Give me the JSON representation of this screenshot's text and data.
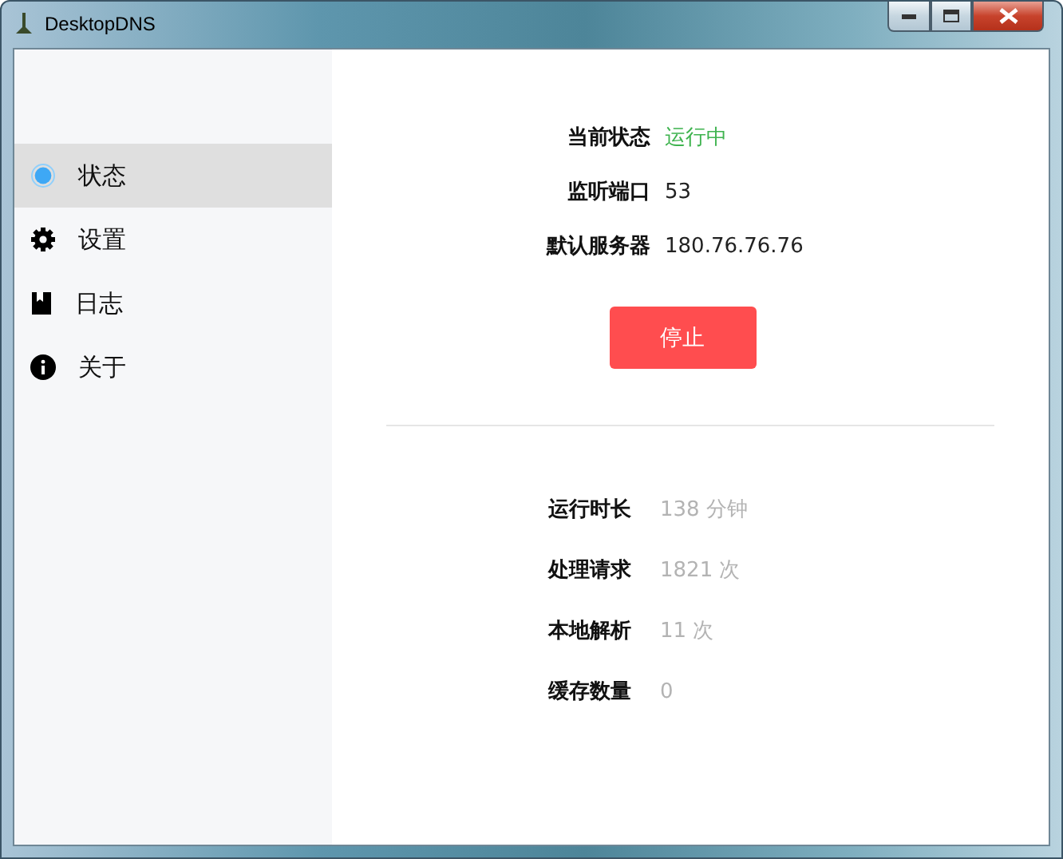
{
  "window": {
    "title": "DesktopDNS"
  },
  "sidebar": {
    "items": [
      {
        "label": "状态",
        "selected": true
      },
      {
        "label": "设置",
        "selected": false
      },
      {
        "label": "日志",
        "selected": false
      },
      {
        "label": "关于",
        "selected": false
      }
    ]
  },
  "status": {
    "rows": [
      {
        "label": "当前状态",
        "value": "运行中",
        "kind": "running"
      },
      {
        "label": "监听端口",
        "value": "53",
        "kind": "text"
      },
      {
        "label": "默认服务器",
        "value": "180.76.76.76",
        "kind": "text"
      }
    ],
    "button": "停止"
  },
  "stats": [
    {
      "label": "运行时长",
      "value": "138 分钟"
    },
    {
      "label": "处理请求",
      "value": "1821 次"
    },
    {
      "label": "本地解析",
      "value": "11 次"
    },
    {
      "label": "缓存数量",
      "value": "0"
    }
  ]
}
